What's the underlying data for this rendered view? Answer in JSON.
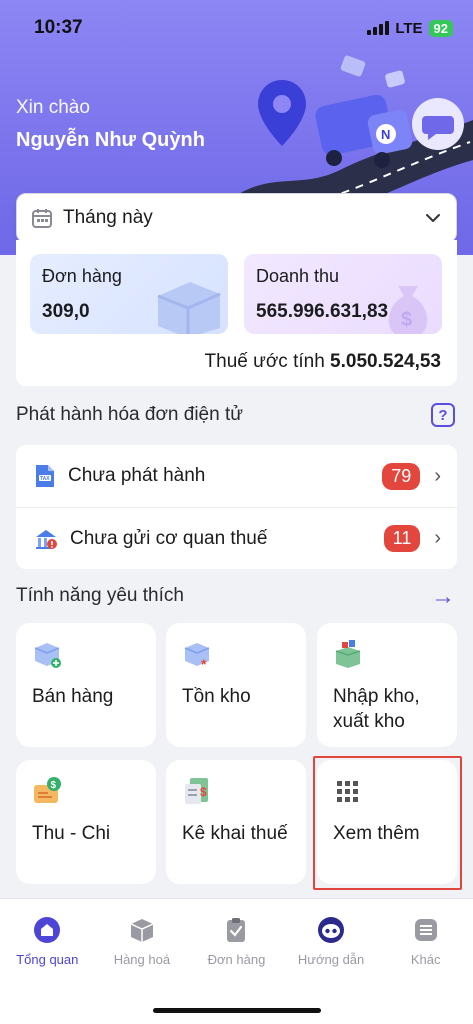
{
  "status_bar": {
    "time": "10:37",
    "network": "LTE",
    "battery": "92"
  },
  "header": {
    "greeting": "Xin chào",
    "user_name": "Nguyễn Như Quỳnh"
  },
  "period": {
    "selected": "Tháng này"
  },
  "stats": {
    "orders_label": "Đơn hàng",
    "orders_value": "309,0",
    "revenue_label": "Doanh thu",
    "revenue_value": "565.996.631,83",
    "tax_label": "Thuế ước tính",
    "tax_value": "5.050.524,53"
  },
  "invoice_section": {
    "title": "Phát hành hóa đơn điện tử",
    "help": "?",
    "rows": [
      {
        "label": "Chưa phát hành",
        "count": "79",
        "icon": "tax-document-icon"
      },
      {
        "label": "Chưa gửi cơ quan thuế",
        "count": "11",
        "icon": "tax-office-icon"
      }
    ]
  },
  "favorites": {
    "title": "Tính năng yêu thích",
    "tiles": [
      {
        "label": "Bán hàng",
        "icon": "box-plus-icon"
      },
      {
        "label": "Tồn kho",
        "icon": "box-asterisk-icon"
      },
      {
        "label": "Nhập kho, xuất kho",
        "icon": "box-transfer-icon"
      },
      {
        "label": "Thu - Chi",
        "icon": "cash-icon"
      },
      {
        "label": "Kê khai thuế",
        "icon": "tax-receipt-icon"
      },
      {
        "label": "Xem thêm",
        "icon": "grid-icon"
      }
    ]
  },
  "tabbar": {
    "tabs": [
      {
        "label": "Tổng quan",
        "icon": "home-icon",
        "active": true
      },
      {
        "label": "Hàng hoá",
        "icon": "box-icon",
        "active": false
      },
      {
        "label": "Đơn hàng",
        "icon": "clipboard-check-icon",
        "active": false
      },
      {
        "label": "Hướng dẫn",
        "icon": "guide-mascot-icon",
        "active": false
      },
      {
        "label": "Khác",
        "icon": "menu-icon",
        "active": false
      }
    ]
  },
  "colors": {
    "accent": "#4d45d6",
    "hero": "#7a73ec",
    "badge": "#e2463c",
    "highlight": "#e0453e"
  }
}
